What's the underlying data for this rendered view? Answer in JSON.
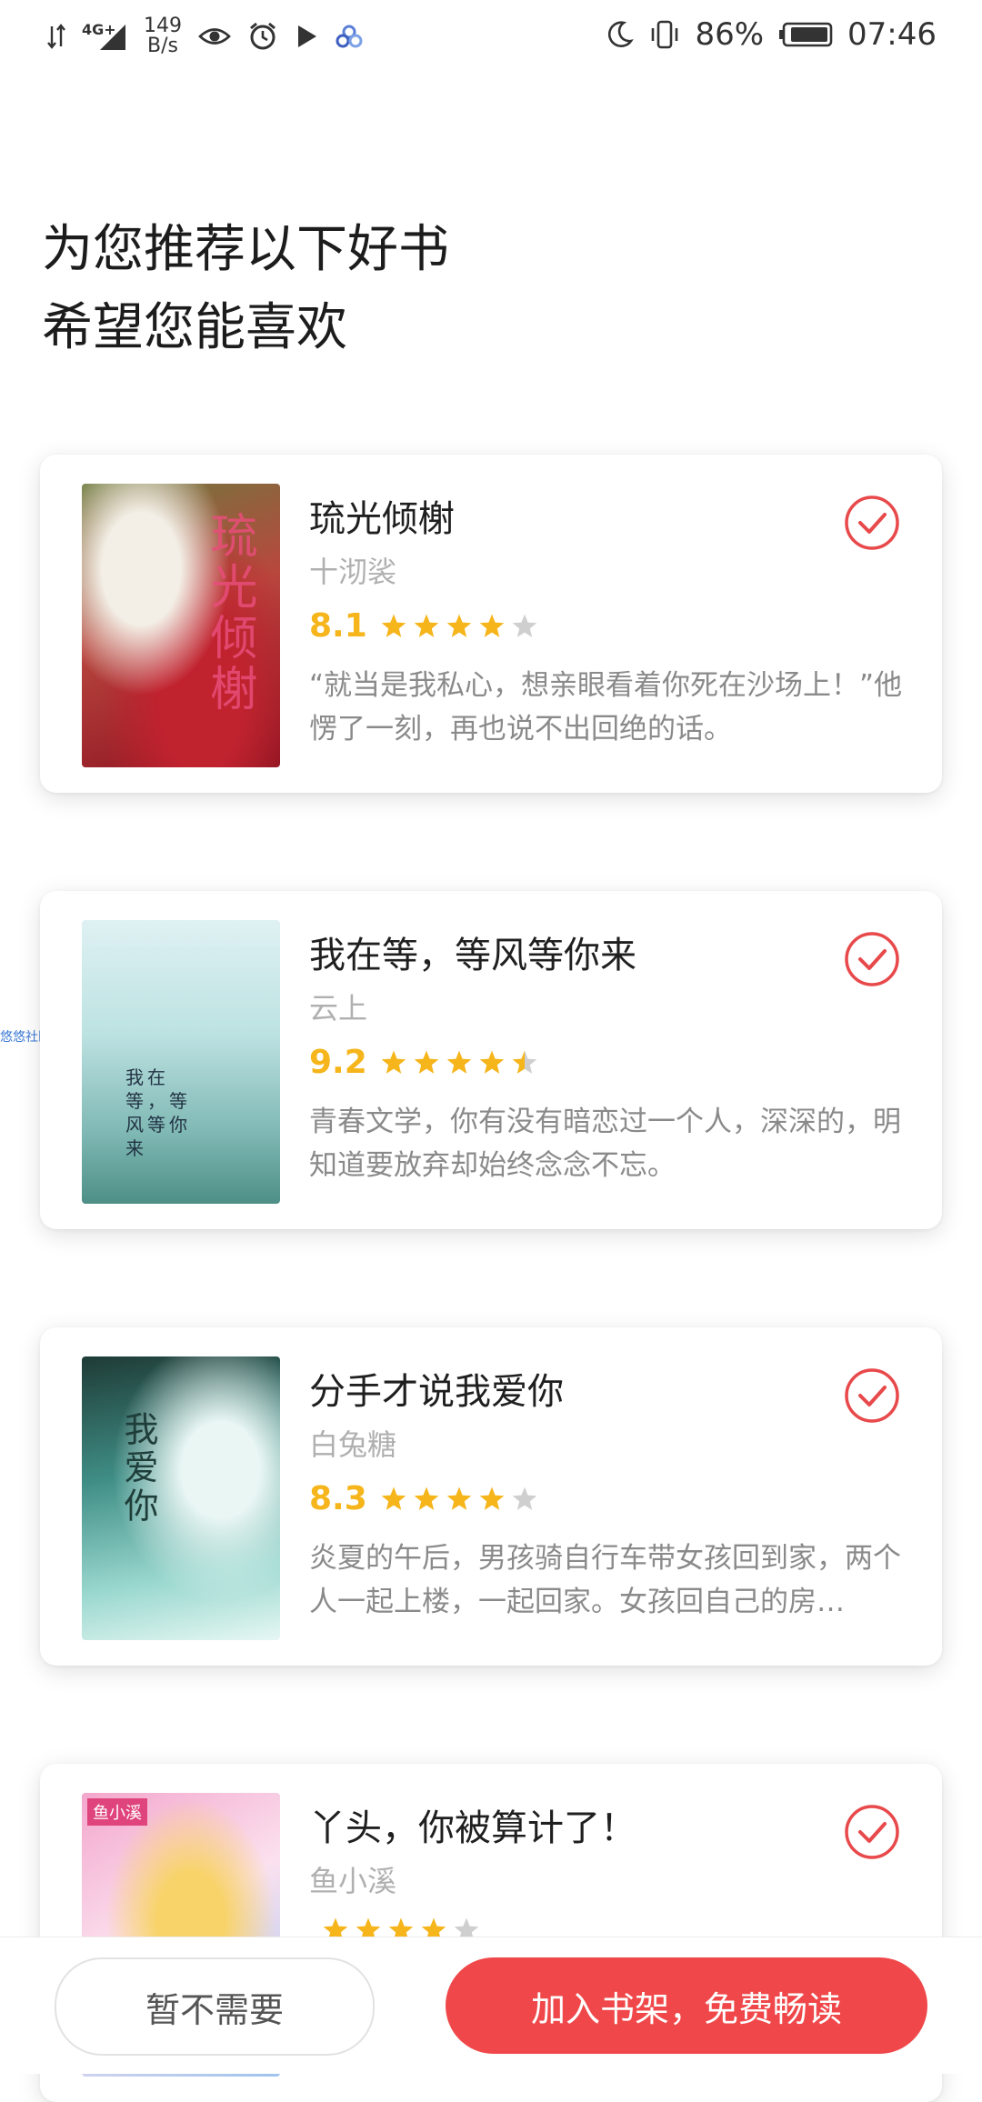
{
  "status_bar": {
    "network": "4G+",
    "speed_value": "149",
    "speed_unit": "B/s",
    "battery": "86%",
    "time": "07:46"
  },
  "heading": {
    "line1": "为您推荐以下好书",
    "line2": "希望您能喜欢"
  },
  "side_tag": "悠悠社区",
  "books": [
    {
      "cover_text": "琉光倾榭",
      "title": "琉光倾榭",
      "author": "十沏裟",
      "score": "8.1",
      "rating": 4.0,
      "desc": "“就当是我私心，想亲眼看着你死在沙场上！”他愣了一刻，再也说不出回绝的话。",
      "selected": true
    },
    {
      "cover_text": "我在等，等风等你来",
      "title": "我在等，等风等你来",
      "author": "云上",
      "score": "9.2",
      "rating": 4.5,
      "desc": "青春文学，你有没有暗恋过一个人，深深的，明知道要放弃却始终念念不忘。",
      "selected": true
    },
    {
      "cover_text": "我爱你",
      "title": "分手才说我爱你",
      "author": "白兔糖",
      "score": "8.3",
      "rating": 4.0,
      "desc": "炎夏的午后，男孩骑自行车带女孩回到家，两个人一起上楼，一起回家。女孩回自己的房…",
      "selected": true
    },
    {
      "cover_text": "鱼小溪",
      "title": "丫头，你被算计了！",
      "author": "鱼小溪",
      "score": "",
      "rating": 4.0,
      "desc": "",
      "selected": true
    }
  ],
  "buttons": {
    "skip": "暂不需要",
    "add": "加入书架，免费畅读"
  },
  "colors": {
    "accent": "#f0484a",
    "star": "#f5b51b",
    "star_empty": "#cfcfcf"
  }
}
